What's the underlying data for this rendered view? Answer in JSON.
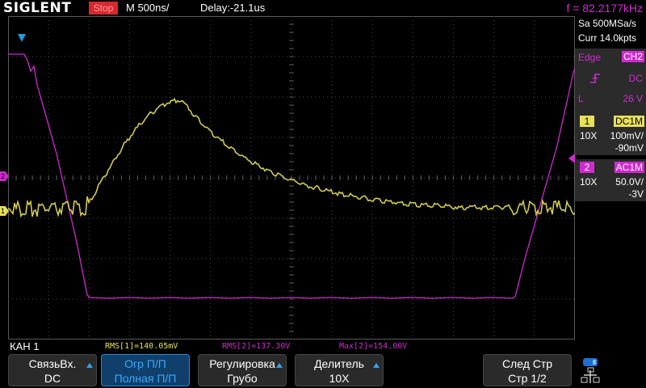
{
  "header": {
    "brand": "SIGLENT",
    "run_state": "Stop",
    "timebase": "M 500ns/",
    "delay": "Delay:-21.1us",
    "frequency": "f = 82.2177kHz"
  },
  "acquisition": {
    "sample_rate": "Sa 500MSa/s",
    "curr_points": "Curr 14.0kpts"
  },
  "trigger": {
    "type": "Edge",
    "source": "CH2",
    "coupling": "DC",
    "level_label": "L",
    "level": "26 V"
  },
  "channels": [
    {
      "num": "1",
      "coupling": "DC1M",
      "probe": "10X",
      "scale": "100mV/",
      "offset": "-90mV",
      "color": "#e8e05a"
    },
    {
      "num": "2",
      "coupling": "AC1M",
      "probe": "10X",
      "scale": "50.0V/",
      "offset": "-3V",
      "color": "#d02ad0"
    }
  ],
  "markers": {
    "ch1": "1",
    "ch2": "2"
  },
  "menu": {
    "title": "КАН 1"
  },
  "measurements": {
    "rms1": "RMS[1]=140.05mV",
    "rms2": "RMS[2]=137.30V",
    "max2": "Max[2]=154.00V"
  },
  "softkeys": [
    {
      "line1": "СвязьВх.",
      "line2": "DC"
    },
    {
      "line1": "Огр П/П",
      "line2": "Полная П/П"
    },
    {
      "line1": "Регулировка",
      "line2": "Грубо"
    },
    {
      "line1": "Делитель",
      "line2": "10X"
    },
    {
      "line1": "След Стр",
      "line2": "Стр 1/2"
    }
  ],
  "colors": {
    "ch1": "#e8e05a",
    "ch2": "#d02ad0",
    "accent": "#2a8ad0",
    "stop": "#d8282f"
  }
}
